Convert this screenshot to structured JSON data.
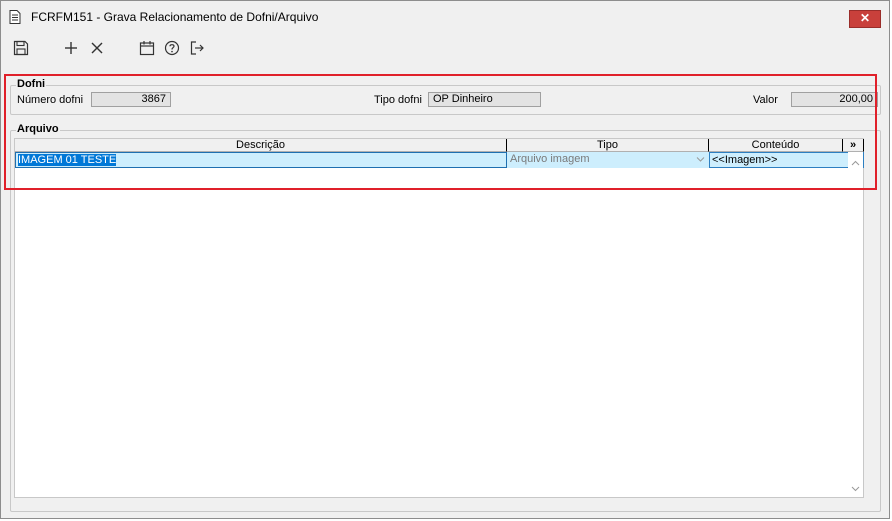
{
  "window": {
    "title": "FCRFM151 - Grava Relacionamento de Dofni/Arquivo",
    "close_label": "✕"
  },
  "toolbar": {
    "buttons": [
      {
        "name": "save",
        "icon": "save-icon"
      },
      {
        "name": "add",
        "icon": "plus-icon"
      },
      {
        "name": "delete",
        "icon": "close-icon"
      },
      {
        "name": "calendar",
        "icon": "calendar-icon"
      },
      {
        "name": "help",
        "icon": "help-icon"
      },
      {
        "name": "exit",
        "icon": "exit-icon"
      }
    ]
  },
  "dofni": {
    "legend": "Dofni",
    "numero_label": "Número dofni",
    "numero_value": "3867",
    "tipo_label": "Tipo dofni",
    "tipo_value": "OP Dinheiro",
    "valor_label": "Valor",
    "valor_value": "200,00"
  },
  "arquivo": {
    "legend": "Arquivo",
    "columns": [
      "Descrição",
      "Tipo",
      "Conteúdo",
      "»"
    ],
    "rows": [
      {
        "descricao": "IMAGEM 01 TESTE",
        "tipo": "Arquivo imagem",
        "conteudo": "<<Imagem>>"
      }
    ]
  },
  "colors": {
    "highlight_border": "#e0202a",
    "selection": "#0078d7",
    "row_fill": "#cdeefd"
  }
}
